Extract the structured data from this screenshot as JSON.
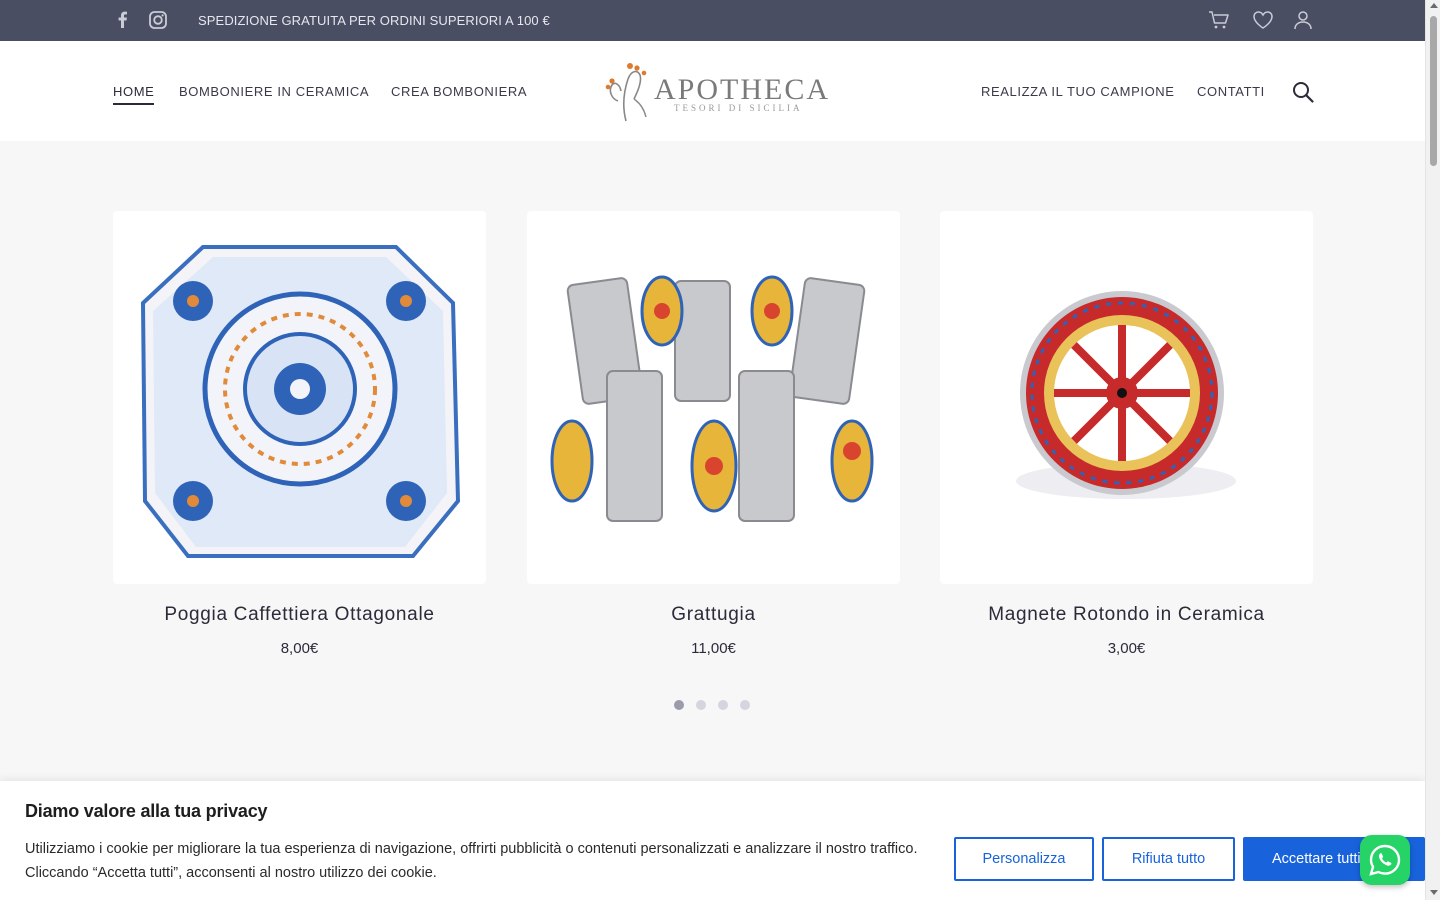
{
  "topbar": {
    "shipping_text": "SPEDIZIONE GRATUITA PER ORDINI SUPERIORI A 100 €",
    "icons": [
      "facebook-icon",
      "instagram-icon",
      "cart-icon",
      "heart-icon",
      "user-icon"
    ]
  },
  "nav": {
    "left": [
      {
        "label": "HOME",
        "active": true
      },
      {
        "label": "BOMBONIERE IN CERAMICA"
      },
      {
        "label": "CREA BOMBONIERA"
      }
    ],
    "right": [
      {
        "label": "REALIZZA IL TUO CAMPIONE"
      },
      {
        "label": "CONTATTI"
      }
    ]
  },
  "logo": {
    "brand": "APOTHECA",
    "tagline": "TESORI DI SICILIA"
  },
  "products": [
    {
      "name": "Poggia Caffettiera Ottagonale",
      "price": "8,00€",
      "image": "octagonal blue floral ceramic trivet"
    },
    {
      "name": "Grattugia",
      "price": "11,00€",
      "image": "graters with painted ceramic handles"
    },
    {
      "name": "Magnete Rotondo in Ceramica",
      "price": "3,00€",
      "image": "round ceramic magnet with cart wheel motif"
    }
  ],
  "carousel": {
    "pages": 4,
    "active_page": 1
  },
  "cookie": {
    "title": "Diamo valore alla tua privacy",
    "text": "Utilizziamo i cookie per migliorare la tua esperienza di navigazione, offrirti pubblicità o contenuti personalizzati e analizzare il nostro traffico. Cliccando “Accetta tutti”, acconsenti al nostro utilizzo dei cookie.",
    "customize_label": "Personalizza",
    "reject_label": "Rifiuta tutto",
    "accept_label": "Accettare tutti"
  },
  "colors": {
    "topbar_bg": "#4a4e63",
    "accent_blue": "#1863dc",
    "whatsapp_green": "#25d366"
  }
}
